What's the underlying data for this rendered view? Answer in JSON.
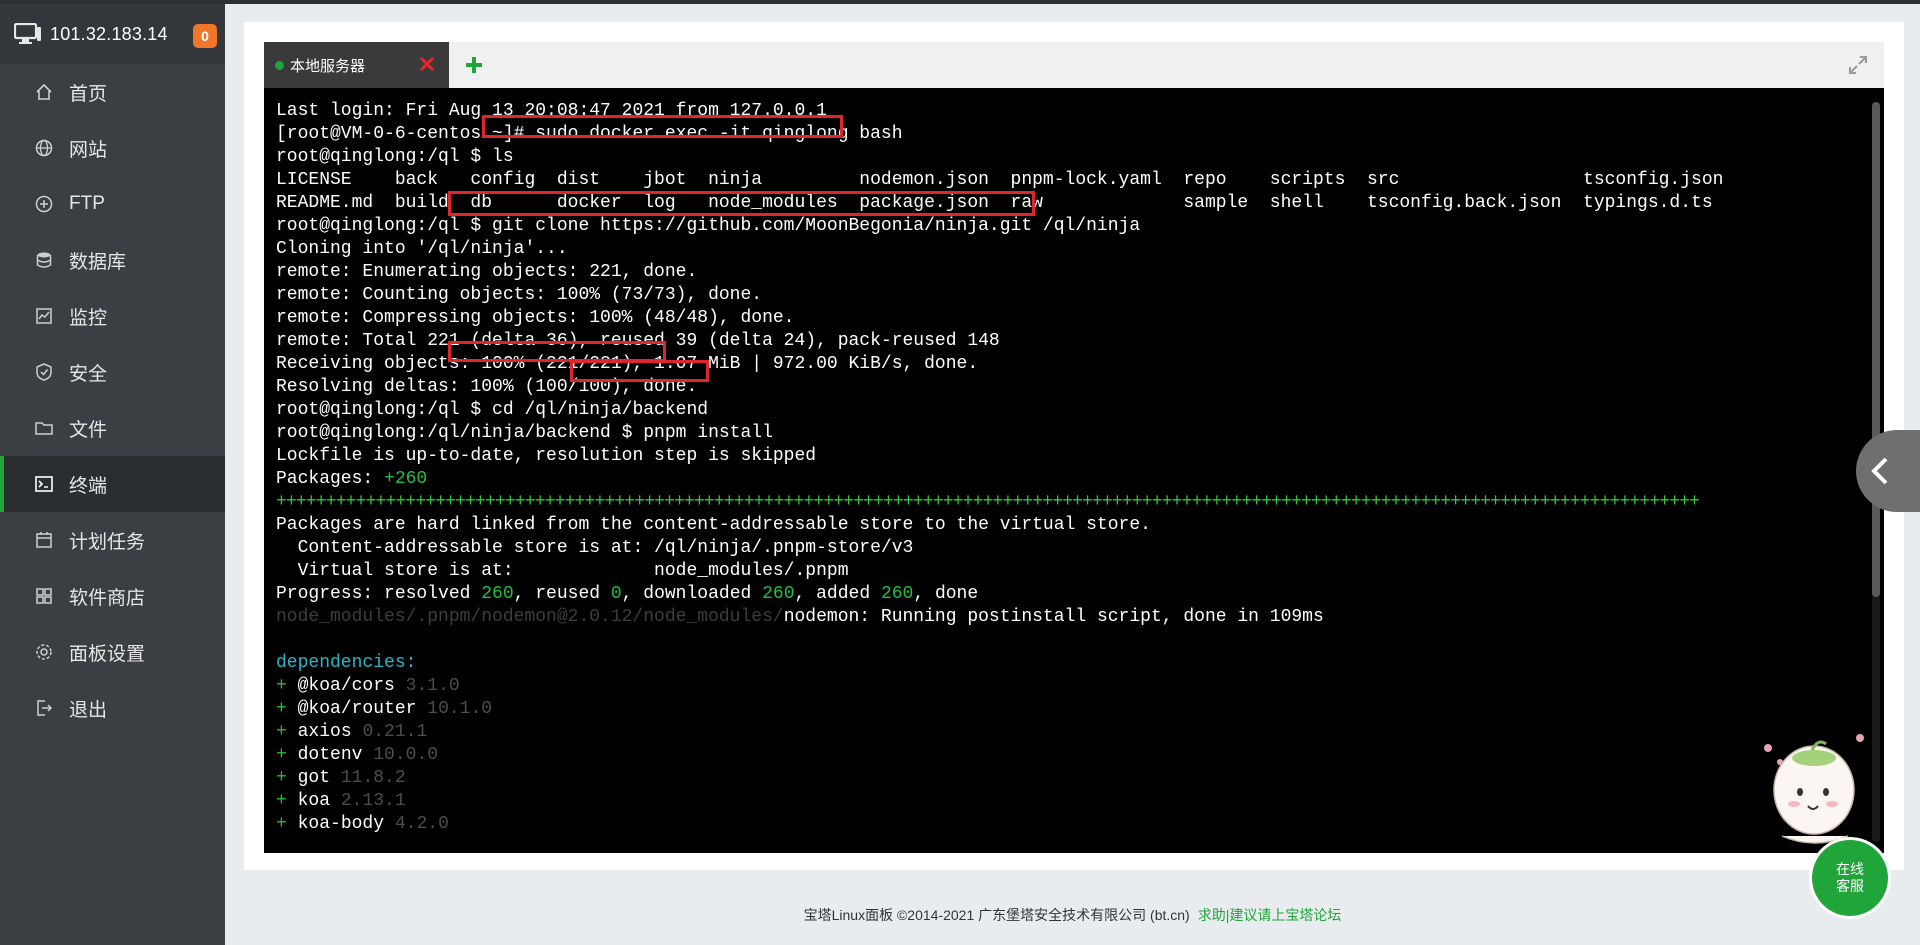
{
  "sidebar": {
    "server_ip": "101.32.183.14",
    "alert_count": "0",
    "items": [
      {
        "label": "首页",
        "icon": "home-icon"
      },
      {
        "label": "网站",
        "icon": "globe-icon"
      },
      {
        "label": "FTP",
        "icon": "ftp-icon"
      },
      {
        "label": "数据库",
        "icon": "database-icon"
      },
      {
        "label": "监控",
        "icon": "monitor-chart-icon"
      },
      {
        "label": "安全",
        "icon": "shield-icon"
      },
      {
        "label": "文件",
        "icon": "folder-icon"
      },
      {
        "label": "终端",
        "icon": "terminal-icon",
        "active": true
      },
      {
        "label": "计划任务",
        "icon": "calendar-icon"
      },
      {
        "label": "软件商店",
        "icon": "grid-icon"
      },
      {
        "label": "面板设置",
        "icon": "gear-icon"
      },
      {
        "label": "退出",
        "icon": "logout-icon"
      }
    ]
  },
  "tabs": {
    "active_label": "本地服务器"
  },
  "terminal": {
    "lines": [
      "Last login: Fri Aug 13 20:08:47 2021 from 127.0.0.1",
      "[root@VM-0-6-centos ~]# sudo docker exec -it qinglong bash",
      "root@qinglong:/ql $ ls",
      "LICENSE    back   config  dist    jbot  ninja         nodemon.json  pnpm-lock.yaml  repo    scripts  src                 tsconfig.json",
      "README.md  build  db      docker  log   node_modules  package.json  raw             sample  shell    tsconfig.back.json  typings.d.ts",
      "root@qinglong:/ql $ git clone https://github.com/MoonBegonia/ninja.git /ql/ninja",
      "Cloning into '/ql/ninja'...",
      "remote: Enumerating objects: 221, done.",
      "remote: Counting objects: 100% (73/73), done.",
      "remote: Compressing objects: 100% (48/48), done.",
      "remote: Total 221 (delta 36), reused 39 (delta 24), pack-reused 148",
      "Receiving objects: 100% (221/221), 1.07 MiB | 972.00 KiB/s, done.",
      "Resolving deltas: 100% (100/100), done.",
      "root@qinglong:/ql $ cd /ql/ninja/backend",
      "root@qinglong:/ql/ninja/backend $ pnpm install",
      "Lockfile is up-to-date, resolution step is skipped"
    ],
    "packages_label": "Packages: ",
    "packages_count": "+260",
    "progress_bar": "+++++++++++++++++++++++++++++++++++++++++++++++++++++++++++++++++++++++++++++++++++++++++++++++++++++++++++++++++++++++++++++++++++++++++++++++",
    "hardlink_lines": [
      "Packages are hard linked from the content-addressable store to the virtual store.",
      "  Content-addressable store is at: /ql/ninja/.pnpm-store/v3",
      "  Virtual store is at:             node_modules/.pnpm"
    ],
    "progress": {
      "prefix": "Progress: resolved ",
      "resolved": "260",
      "reused_label": ", reused ",
      "reused": "0",
      "downloaded_label": ", downloaded ",
      "downloaded": "260",
      "added_label": ", added ",
      "added": "260",
      "suffix": ", done"
    },
    "postinstall_path": "node_modules/.pnpm/nodemon@2.0.12/node_modules/",
    "postinstall_text": "nodemon: Running postinstall script, done in 109ms",
    "deps_header": "dependencies:",
    "deps": [
      {
        "name": "@koa/cors",
        "version": "3.1.0"
      },
      {
        "name": "@koa/router",
        "version": "10.1.0"
      },
      {
        "name": "axios",
        "version": "0.21.1"
      },
      {
        "name": "dotenv",
        "version": "10.0.0"
      },
      {
        "name": "got",
        "version": "11.8.2"
      },
      {
        "name": "koa",
        "version": "2.13.1"
      },
      {
        "name": "koa-body",
        "version": "4.2.0"
      }
    ]
  },
  "chat": {
    "line1": "在线",
    "line2": "客服"
  },
  "footer": {
    "copyright": "宝塔Linux面板 ©2014-2021 广东堡塔安全技术有限公司 (bt.cn)",
    "link": "求助|建议请上宝塔论坛"
  },
  "colors": {
    "accent": "#20a53a",
    "highlight_box": "#e0262d",
    "badge": "#f0772a"
  }
}
